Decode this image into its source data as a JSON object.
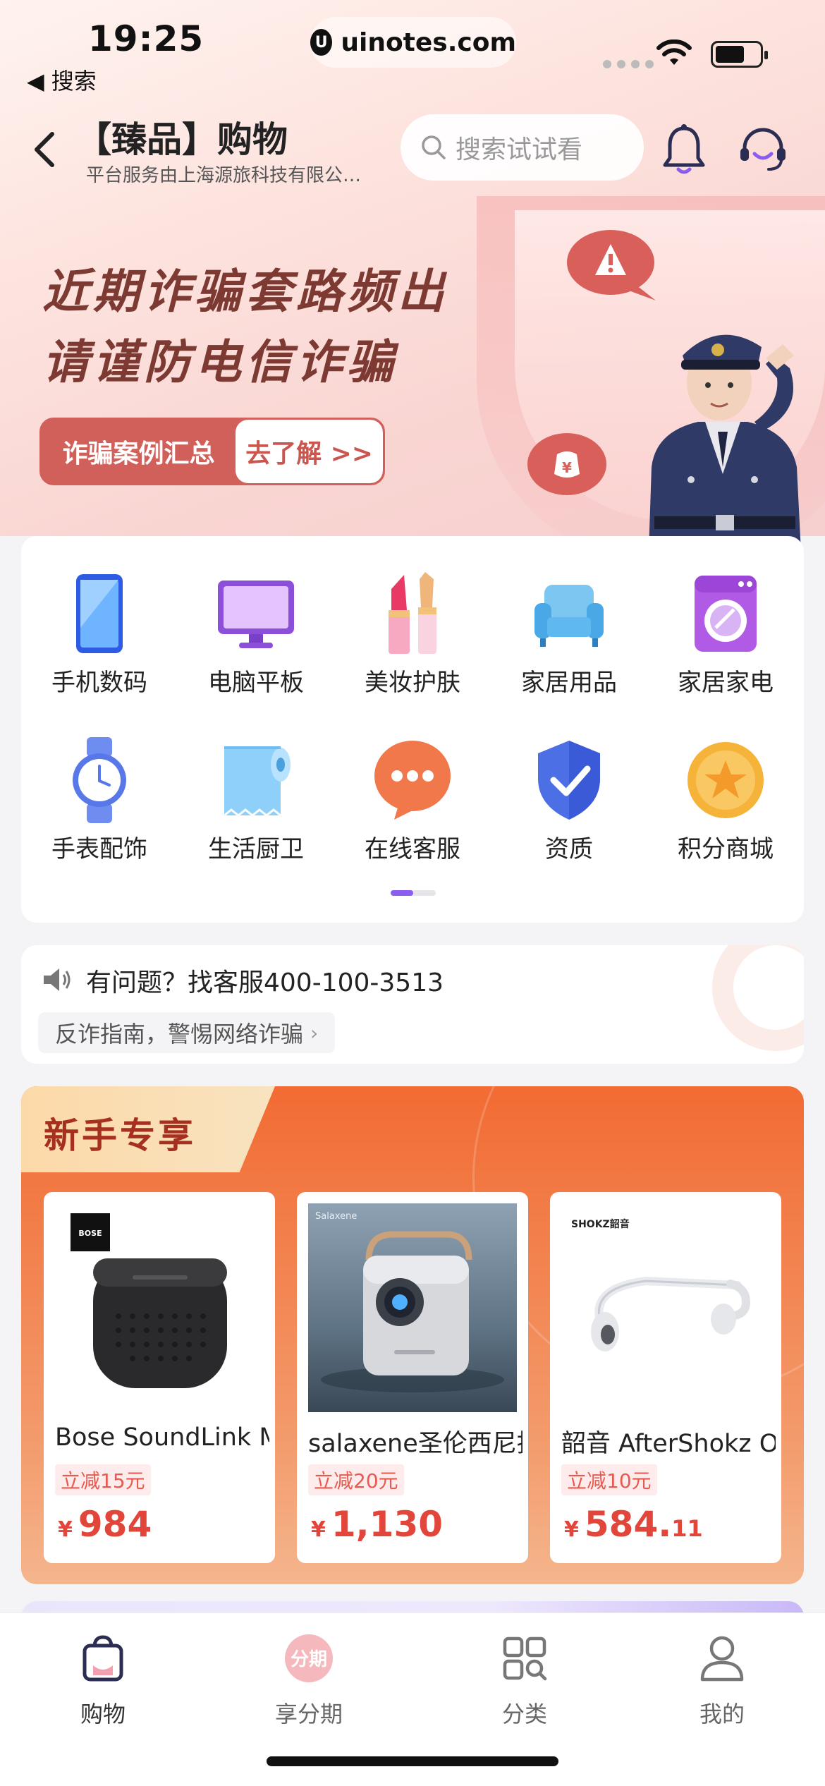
{
  "status_bar": {
    "time": "19:25",
    "back_app": "◀ 搜索",
    "url": "uinotes.com"
  },
  "header": {
    "title": "【臻品】购物",
    "subtitle": "平台服务由上海源旅科技有限公司...",
    "search_placeholder": "搜索试试看"
  },
  "banner": {
    "line1": "近期诈骗套路频出",
    "line2": "请谨防电信诈骗",
    "button_left": "诈骗案例汇总",
    "button_right": "去了解 >>",
    "colors": {
      "accent": "#d2605a",
      "text": "#7d3a32"
    }
  },
  "categories": [
    {
      "label": "手机数码",
      "icon": "phone-icon"
    },
    {
      "label": "电脑平板",
      "icon": "monitor-icon"
    },
    {
      "label": "美妆护肤",
      "icon": "lipstick-icon"
    },
    {
      "label": "家居用品",
      "icon": "sofa-icon"
    },
    {
      "label": "家居家电",
      "icon": "washing-machine-icon"
    },
    {
      "label": "手表配饰",
      "icon": "watch-icon"
    },
    {
      "label": "生活厨卫",
      "icon": "tissue-roll-icon"
    },
    {
      "label": "在线客服",
      "icon": "chat-bubble-icon"
    },
    {
      "label": "资质",
      "icon": "shield-check-icon"
    },
    {
      "label": "积分商城",
      "icon": "star-coin-icon"
    }
  ],
  "service": {
    "hotline": "有问题？找客服400-100-3513",
    "guide": "反诈指南，警惕网络诈骗"
  },
  "newbie": {
    "title": "新手专享",
    "products": [
      {
        "name": "Bose SoundLink Micro",
        "tag": "立减15元",
        "currency": "¥",
        "price_int": "984",
        "price_dec": "",
        "brand": "BOSE"
      },
      {
        "name": "salaxene圣伦西尼投影仪",
        "tag": "立减20元",
        "currency": "¥",
        "price_int": "1,130",
        "price_dec": "",
        "brand": "Salaxene"
      },
      {
        "name": "韶音 AfterShokz OpenMove",
        "tag": "立减10元",
        "currency": "¥",
        "price_int": "584.",
        "price_dec": "11",
        "brand": "SHOKZ韶音"
      }
    ]
  },
  "tabbar": [
    {
      "label": "购物",
      "icon": "shopping-bag-icon",
      "active": true
    },
    {
      "label": "享分期",
      "icon": "installment-icon",
      "active": false,
      "icon_text": "分期"
    },
    {
      "label": "分类",
      "icon": "category-grid-icon",
      "active": false
    },
    {
      "label": "我的",
      "icon": "profile-icon",
      "active": false
    }
  ]
}
